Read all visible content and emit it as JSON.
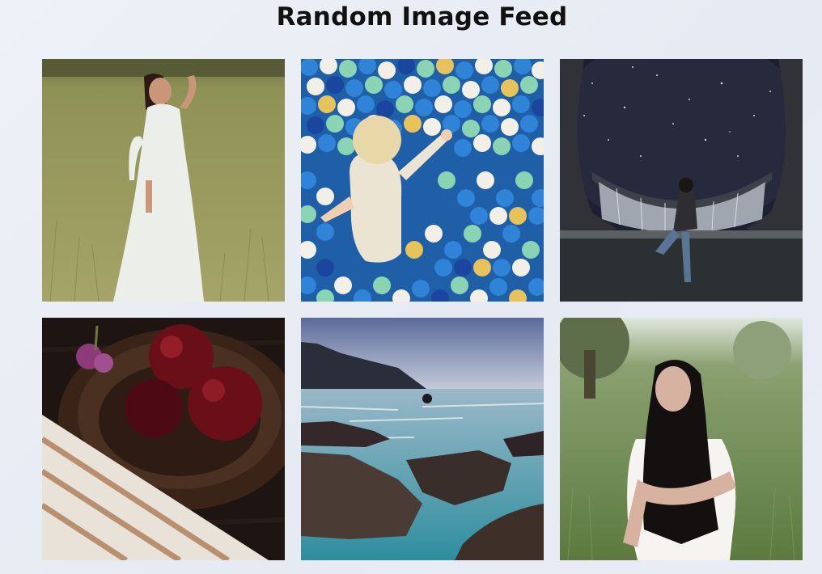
{
  "page": {
    "title": "Random Image Feed"
  },
  "feed": {
    "images": [
      {
        "subject": "woman in white dress in a grass field",
        "palette": [
          "#9a9c62",
          "#eef0ec",
          "#2a1a12"
        ]
      },
      {
        "subject": "toddler in a ball pit",
        "palette": [
          "#2f84d8",
          "#f2f0e6",
          "#8ad4b4"
        ]
      },
      {
        "subject": "person sitting under a starry sky dome",
        "palette": [
          "#1c2030",
          "#313238",
          "#d8dce2"
        ]
      },
      {
        "subject": "red apples in a wooden bowl",
        "palette": [
          "#6a0e18",
          "#3a2418",
          "#e8e2d8"
        ]
      },
      {
        "subject": "rocky coastline with sea and cliffs",
        "palette": [
          "#7882aa",
          "#2e8e9e",
          "#4a3c34"
        ]
      },
      {
        "subject": "dark-haired woman in green field",
        "palette": [
          "#6a8a4c",
          "#f6f4f0",
          "#141010"
        ]
      }
    ]
  }
}
